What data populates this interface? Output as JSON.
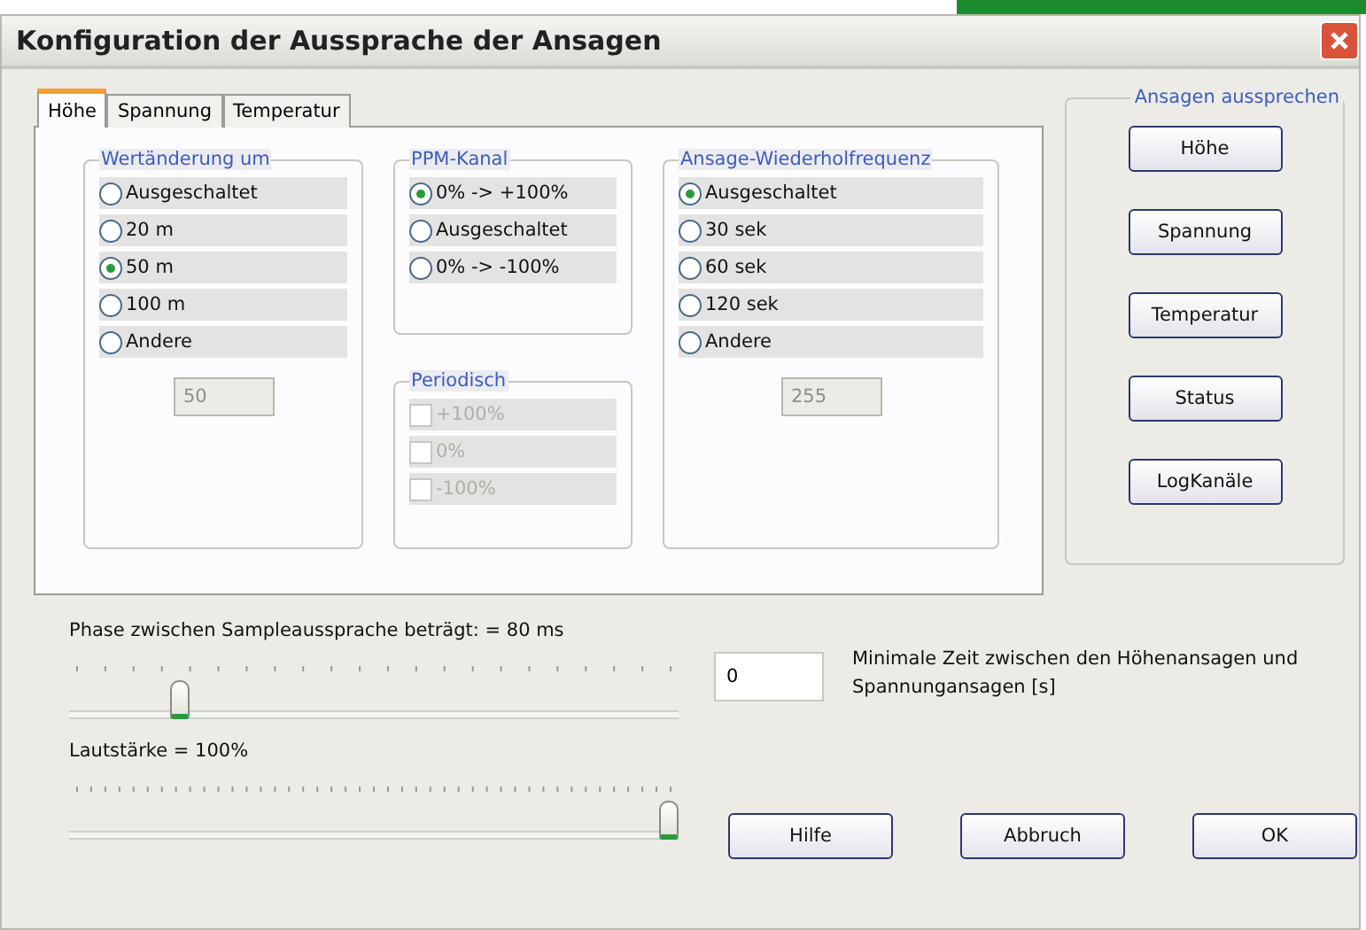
{
  "window": {
    "title": "Konfiguration der Aussprache der Ansagen"
  },
  "tabs": [
    {
      "label": "Höhe",
      "selected": true
    },
    {
      "label": "Spannung",
      "selected": false
    },
    {
      "label": "Temperatur",
      "selected": false
    }
  ],
  "groups": {
    "change": {
      "title": "Wertänderung um",
      "options": [
        {
          "label": "Ausgeschaltet",
          "selected": false
        },
        {
          "label": "20 m",
          "selected": false
        },
        {
          "label": "50 m",
          "selected": true
        },
        {
          "label": "100 m",
          "selected": false
        },
        {
          "label": "Andere",
          "selected": false
        }
      ],
      "field": {
        "value": "50",
        "disabled": true
      }
    },
    "ppm": {
      "title": "PPM-Kanal",
      "options": [
        {
          "label": "0% -> +100%",
          "selected": true
        },
        {
          "label": "Ausgeschaltet",
          "selected": false
        },
        {
          "label": "0% -> -100%",
          "selected": false
        }
      ]
    },
    "periodic": {
      "title": "Periodisch",
      "options": [
        {
          "label": "+100%",
          "checked": false,
          "disabled": true
        },
        {
          "label": "0%",
          "checked": false,
          "disabled": true
        },
        {
          "label": "-100%",
          "checked": false,
          "disabled": true
        }
      ]
    },
    "repeat": {
      "title": "Ansage-Wiederholfrequenz",
      "options": [
        {
          "label": "Ausgeschaltet",
          "selected": true
        },
        {
          "label": "30 sek",
          "selected": false
        },
        {
          "label": "60 sek",
          "selected": false
        },
        {
          "label": "120 sek",
          "selected": false
        },
        {
          "label": "Andere",
          "selected": false
        }
      ],
      "field": {
        "value": "255",
        "disabled": true
      }
    }
  },
  "speak": {
    "title": "Ansagen aussprechen",
    "buttons": [
      "Höhe",
      "Spannung",
      "Temperatur",
      "Status",
      "LogKanäle"
    ]
  },
  "sliders": [
    {
      "label": "Phase zwischen Sampleaussprache beträgt: = 80 ms",
      "level": 0.17
    },
    {
      "label": "Lautstärke = 100%",
      "level": 1
    }
  ],
  "min_time": {
    "value": "0",
    "label": "Minimale Zeit zwischen den Höhenansagen und Spannungansagen [s]"
  },
  "buttons": [
    "Hilfe",
    "Abbruch",
    "OK"
  ]
}
